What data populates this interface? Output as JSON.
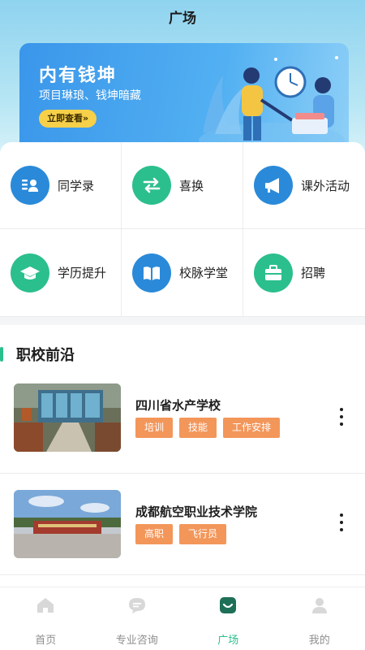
{
  "header": {
    "title": "广场"
  },
  "banner": {
    "title": "内有钱坤",
    "subtitle": "项目琳琅、钱坤暗藏",
    "button_label": "立即查看»"
  },
  "grid": [
    {
      "label": "同学录",
      "icon": "contacts-icon",
      "color": "#2a8ad9"
    },
    {
      "label": "喜换",
      "icon": "swap-icon",
      "color": "#2bbf8d"
    },
    {
      "label": "课外活动",
      "icon": "megaphone-icon",
      "color": "#2a8ad9"
    },
    {
      "label": "学历提升",
      "icon": "graduation-cap-icon",
      "color": "#2bbf8d"
    },
    {
      "label": "校脉学堂",
      "icon": "book-icon",
      "color": "#2a8ad9"
    },
    {
      "label": "招聘",
      "icon": "briefcase-icon",
      "color": "#2bbf8d"
    }
  ],
  "section": {
    "title": "职校前沿"
  },
  "schools": [
    {
      "name": "四川省水产学校",
      "tags": [
        "培训",
        "技能",
        "工作安排"
      ]
    },
    {
      "name": "成都航空职业技术学院",
      "tags": [
        "高职",
        "飞行员"
      ]
    }
  ],
  "tabbar": {
    "items": [
      {
        "label": "首页",
        "icon": "home-icon",
        "active": false
      },
      {
        "label": "专业咨询",
        "icon": "chat-icon",
        "active": false
      },
      {
        "label": "广场",
        "icon": "plaza-icon",
        "active": true
      },
      {
        "label": "我的",
        "icon": "profile-icon",
        "active": false
      }
    ]
  },
  "colors": {
    "accent": "#2bbf8d",
    "blue": "#2a8ad9",
    "tag": "#f3965a",
    "banner_button": "#f7d04a"
  }
}
